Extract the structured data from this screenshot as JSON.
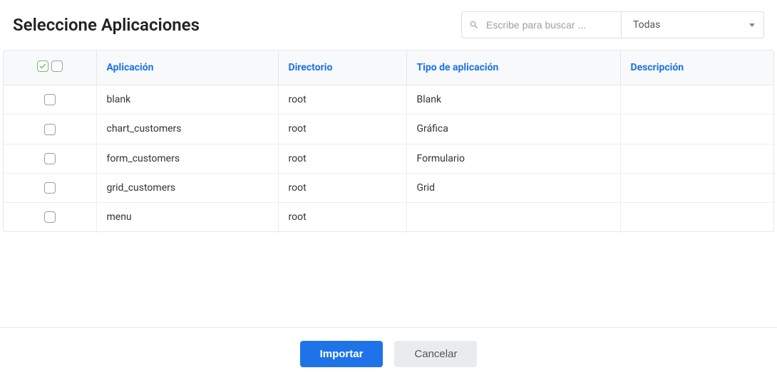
{
  "header": {
    "title": "Seleccione Aplicaciones",
    "search_placeholder": "Escribe para buscar ...",
    "filter_selected": "Todas"
  },
  "table": {
    "columns": {
      "app": "Aplicación",
      "dir": "Directorio",
      "type": "Tipo de aplicación",
      "desc": "Descripción"
    },
    "rows": [
      {
        "app": "blank",
        "dir": "root",
        "type": "Blank",
        "desc": ""
      },
      {
        "app": "chart_customers",
        "dir": "root",
        "type": "Gráfica",
        "desc": ""
      },
      {
        "app": "form_customers",
        "dir": "root",
        "type": "Formulario",
        "desc": ""
      },
      {
        "app": "grid_customers",
        "dir": "root",
        "type": "Grid",
        "desc": ""
      },
      {
        "app": "menu",
        "dir": "root",
        "type": "",
        "desc": ""
      }
    ]
  },
  "footer": {
    "import": "Importar",
    "cancel": "Cancelar"
  }
}
